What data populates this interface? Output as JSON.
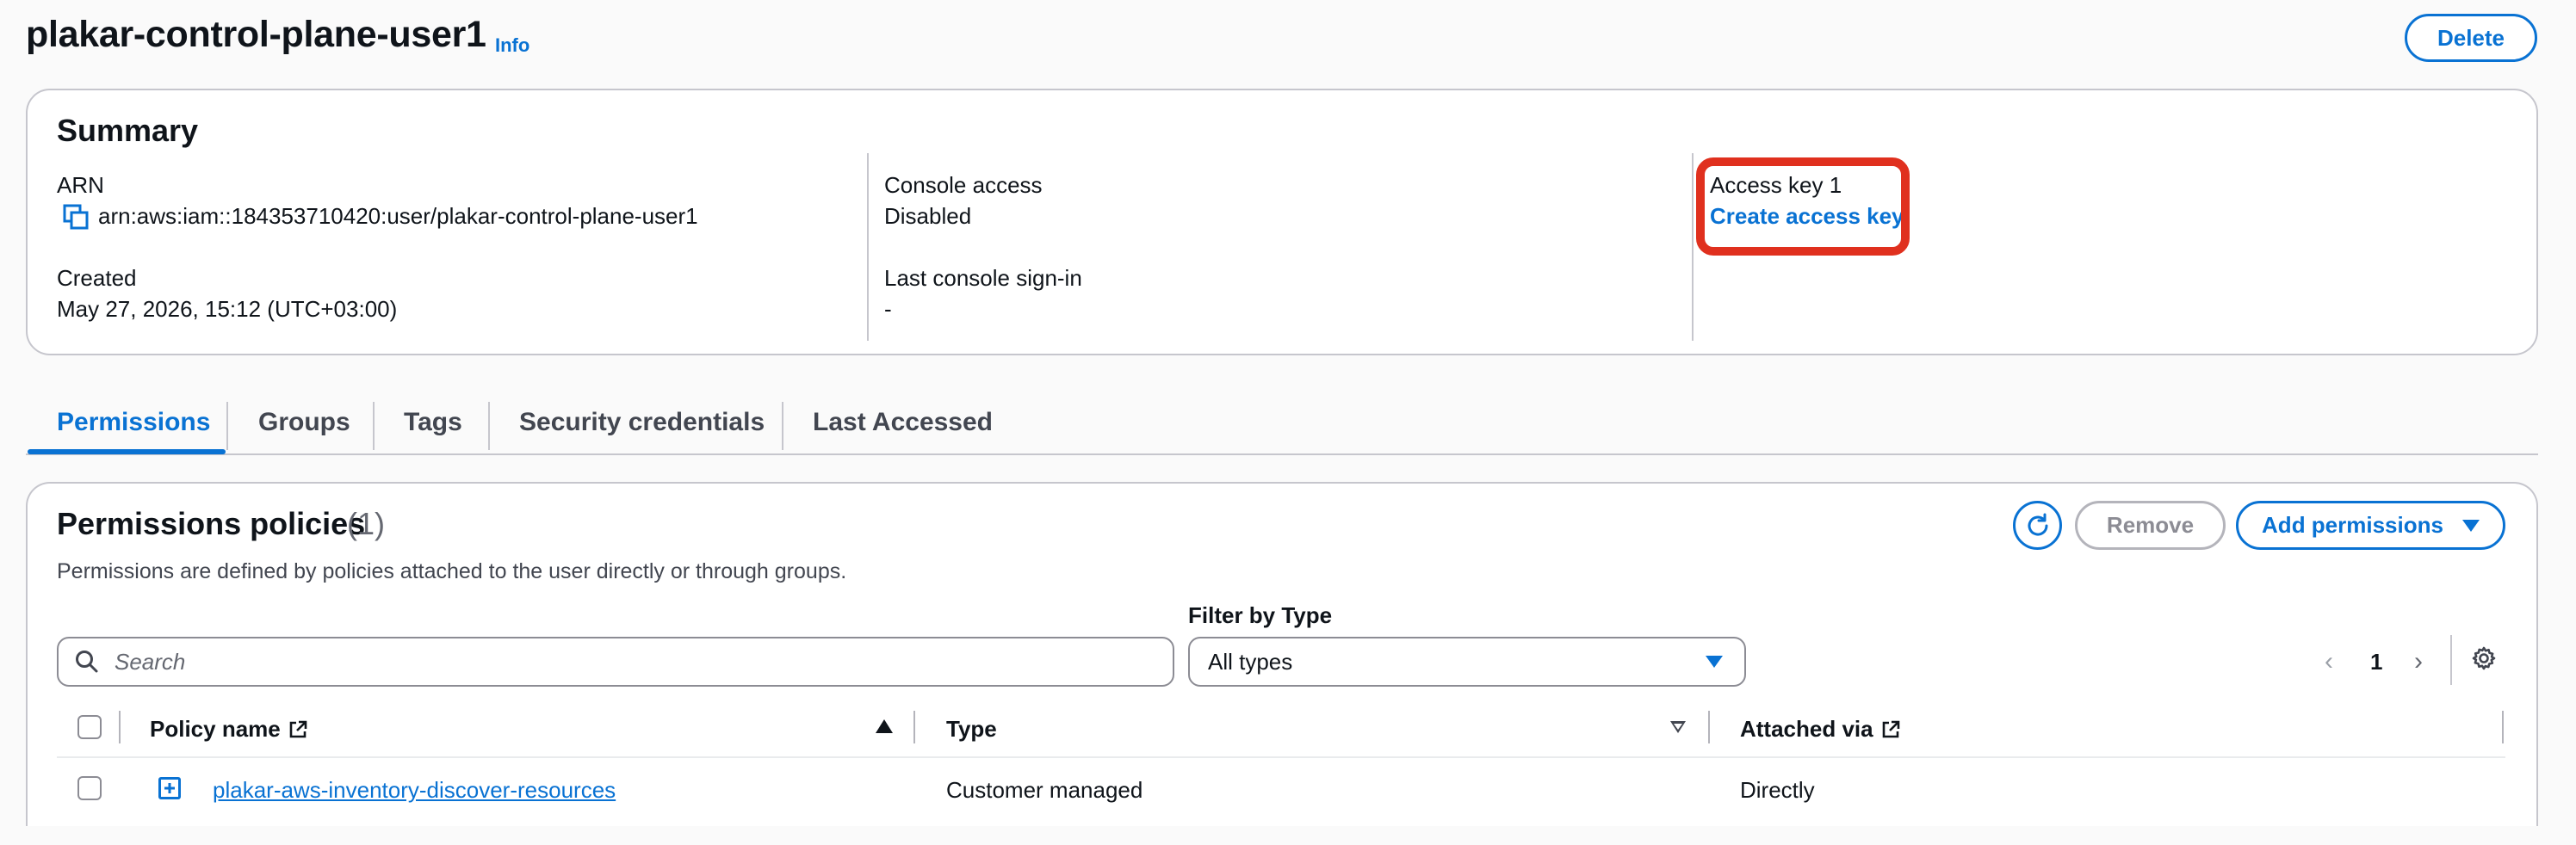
{
  "header": {
    "title": "plakar-control-plane-user1",
    "info_label": "Info",
    "delete_label": "Delete"
  },
  "summary": {
    "title": "Summary",
    "arn_label": "ARN",
    "arn_value": "arn:aws:iam::184353710420:user/plakar-control-plane-user1",
    "created_label": "Created",
    "created_value": "May 27, 2026, 15:12 (UTC+03:00)",
    "console_access_label": "Console access",
    "console_access_value": "Disabled",
    "last_signin_label": "Last console sign-in",
    "last_signin_value": "-",
    "access_key_label": "Access key 1",
    "create_access_key_label": "Create access key",
    "highlight_color": "#e0301e"
  },
  "tabs": [
    {
      "label": "Permissions",
      "active": true
    },
    {
      "label": "Groups",
      "active": false
    },
    {
      "label": "Tags",
      "active": false
    },
    {
      "label": "Security credentials",
      "active": false
    },
    {
      "label": "Last Accessed",
      "active": false
    }
  ],
  "permissions": {
    "title": "Permissions policies",
    "count": "(1)",
    "description": "Permissions are defined by policies attached to the user directly or through groups.",
    "remove_label": "Remove",
    "add_label": "Add permissions",
    "search_placeholder": "Search",
    "filter_label": "Filter by Type",
    "filter_value": "All types",
    "page_number": "1",
    "columns": {
      "policy_name": "Policy name",
      "type": "Type",
      "attached_via": "Attached via"
    },
    "rows": [
      {
        "policy_name": "plakar-aws-inventory-discover-resources",
        "type": "Customer managed",
        "attached_via": "Directly"
      }
    ]
  },
  "colors": {
    "accent": "#0972d3",
    "text": "#0f141a",
    "border": "#c6c6cd"
  }
}
